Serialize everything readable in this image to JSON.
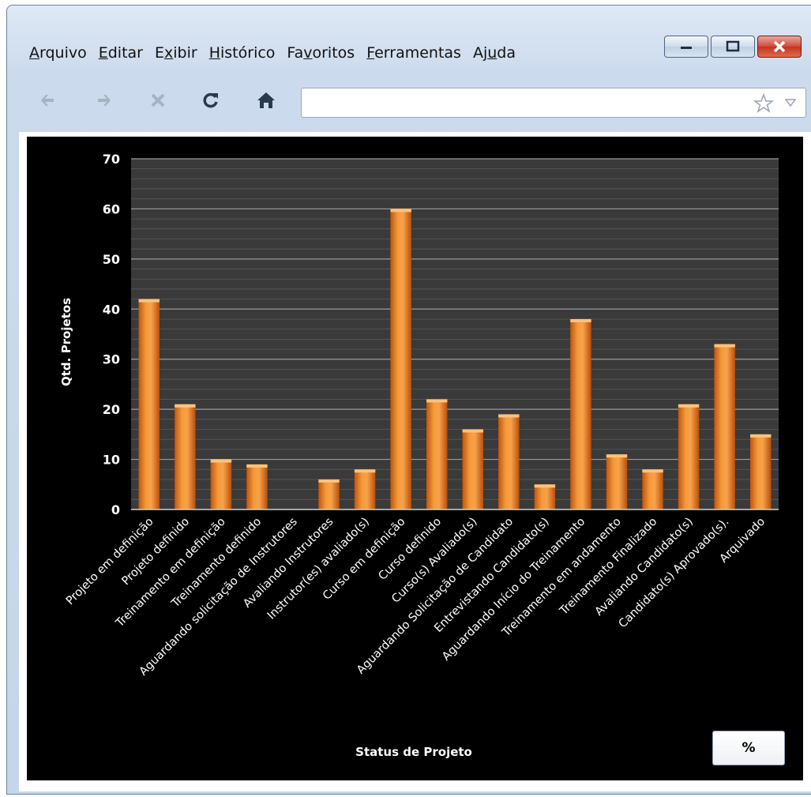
{
  "browser": {
    "menu": [
      {
        "label": "Arquivo",
        "access_key": "A"
      },
      {
        "label": "Editar",
        "access_key": "E"
      },
      {
        "label": "Exibir",
        "access_key": "x"
      },
      {
        "label": "Histórico",
        "access_key": "H"
      },
      {
        "label": "Favoritos",
        "access_key": "v"
      },
      {
        "label": "Ferramentas",
        "access_key": "F"
      },
      {
        "label": "Ajuda",
        "access_key": "u"
      }
    ],
    "nav_icons": [
      "back-icon",
      "forward-icon",
      "stop-icon",
      "reload-icon",
      "home-icon"
    ],
    "url": "",
    "window_controls": [
      "minimize-icon",
      "maximize-icon",
      "close-icon"
    ]
  },
  "chart_data": {
    "type": "bar",
    "title": "",
    "xlabel": "Status de Projeto",
    "ylabel": "Qtd. Projetos",
    "ylim": [
      0,
      70
    ],
    "yticks": [
      0,
      10,
      20,
      30,
      40,
      50,
      60,
      70
    ],
    "grid": true,
    "bar_color": "#f08a24",
    "categories": [
      "Projeto em definição",
      "Projeto definido",
      "Treinamento em definição",
      "Treinamento definido",
      "Aguardando solicitação de Instrutores",
      "Avaliando Instrutores",
      "Instrutor(es) avaliado(s)",
      "Curso em definição",
      "Curso definido",
      "Curso(s) Avaliado(s)",
      "Aguardando Solicitação de Candidato",
      "Entrevistando Candidato(s)",
      "Aguardando Início do Treinamento",
      "Treinamento em andamento",
      "Treinamento Finalizado",
      "Avaliando Candidato(s)",
      "Candidato(s) Aprovado(s).",
      "Arquivado"
    ],
    "values": [
      42,
      21,
      10,
      9,
      0,
      6,
      8,
      60,
      22,
      16,
      19,
      5,
      38,
      11,
      8,
      21,
      33,
      15
    ]
  },
  "percent_button": "%"
}
